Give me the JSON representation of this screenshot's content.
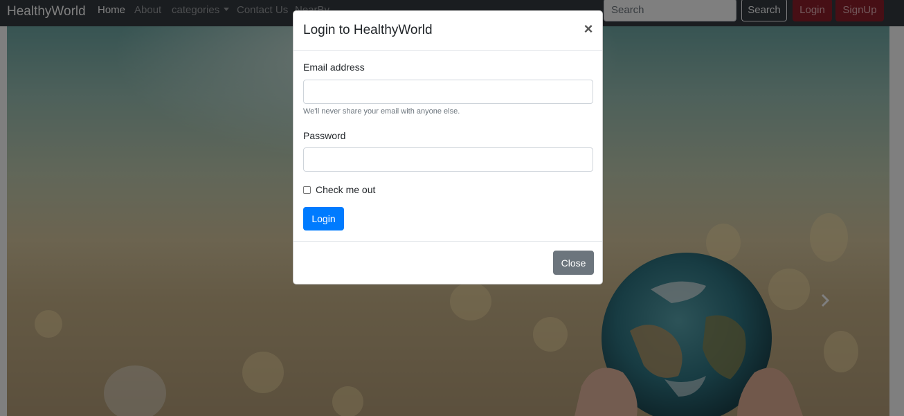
{
  "navbar": {
    "brand": "HealthyWorld",
    "links": [
      {
        "label": "Home",
        "active": true
      },
      {
        "label": "About",
        "active": false
      },
      {
        "label": "categories",
        "active": false,
        "dropdown": true
      },
      {
        "label": "Contact Us",
        "active": false
      },
      {
        "label": "NearBy",
        "active": false
      }
    ],
    "search": {
      "placeholder": "Search",
      "value": ""
    },
    "search_button": "Search",
    "login_button": "Login",
    "signup_button": "SignUp"
  },
  "carousel": {
    "next_icon": "chevron-right-icon"
  },
  "modal": {
    "title": "Login to HealthyWorld",
    "close_icon": "close-icon",
    "close_symbol": "×",
    "email_label": "Email address",
    "email_value": "",
    "email_help": "We'll never share your email with anyone else.",
    "password_label": "Password",
    "password_value": "",
    "checkbox_label": "Check me out",
    "checkbox_checked": false,
    "submit_button": "Login",
    "close_button": "Close"
  },
  "colors": {
    "navbar_bg": "#343a40",
    "primary": "#007bff",
    "secondary": "#6c757d",
    "danger": "#dc3545"
  }
}
